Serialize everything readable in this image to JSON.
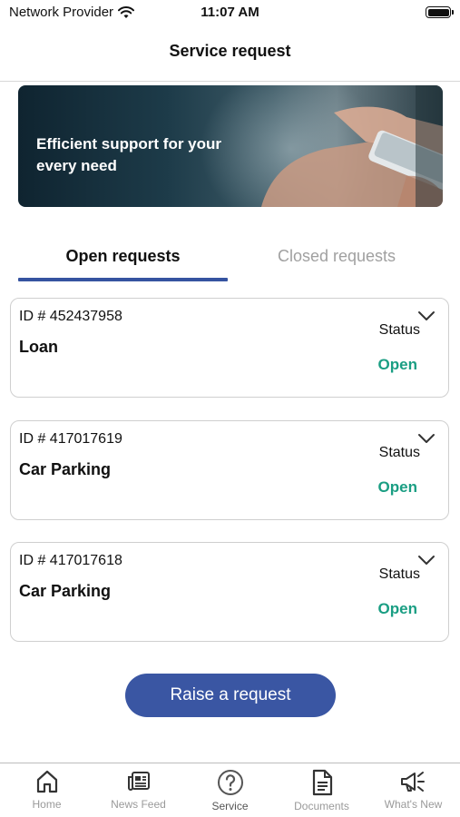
{
  "status_bar": {
    "carrier": "Network Provider",
    "time": "11:07 AM"
  },
  "header": {
    "title": "Service request"
  },
  "banner": {
    "text": "Efficient support for your every need"
  },
  "tabs": [
    {
      "label": "Open requests",
      "active": true
    },
    {
      "label": "Closed requests",
      "active": false
    }
  ],
  "requests": [
    {
      "id": "ID # 452437958",
      "name": "Loan",
      "status_label": "Status",
      "status": "Open"
    },
    {
      "id": "ID # 417017619",
      "name": "Car Parking",
      "status_label": "Status",
      "status": "Open"
    },
    {
      "id": "ID # 417017618",
      "name": "Car Parking",
      "status_label": "Status",
      "status": "Open"
    }
  ],
  "raise_button": {
    "label": "Raise a request"
  },
  "bottom_nav": [
    {
      "label": "Home",
      "icon": "home-icon",
      "active": false
    },
    {
      "label": "News Feed",
      "icon": "news-feed-icon",
      "active": false
    },
    {
      "label": "Service",
      "icon": "help-circle-icon",
      "active": true
    },
    {
      "label": "Documents",
      "icon": "document-icon",
      "active": false
    },
    {
      "label": "What's New",
      "icon": "megaphone-icon",
      "active": false
    }
  ],
  "colors": {
    "accent": "#3a56a3",
    "tab_underline": "#3553a0",
    "status_open": "#1a9e83"
  }
}
